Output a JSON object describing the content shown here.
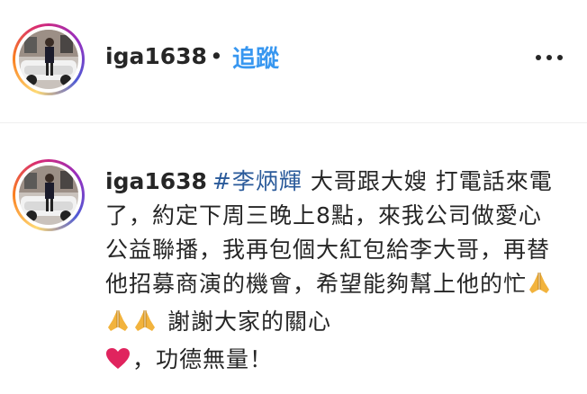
{
  "post_header": {
    "username": "iga1638",
    "separator": "•",
    "follow_label": "追蹤",
    "more_icon": "more-horizontal-icon"
  },
  "comment": {
    "username": "iga1638",
    "hashtag": "#李炳輝",
    "text_part1": " 大哥跟大嫂 打電話來電了，約定下周三晚上8點，來我公司做愛心公益聯播，我再包個大紅包給李大哥，再替他招募商演的機會，希望能夠幫上他的忙",
    "emojis": [
      "folded-hands-emoji",
      "folded-hands-emoji",
      "folded-hands-emoji",
      "red-heart-emoji"
    ],
    "text_part2": " 謝謝大家的關心",
    "text_part3": "，功德無量！"
  },
  "colors": {
    "link_blue": "#3897f0",
    "hashtag": "#2a5a9a",
    "text": "#262626",
    "divider": "#efefef",
    "heart": "#e0245e",
    "hands": "#f2b33d"
  }
}
